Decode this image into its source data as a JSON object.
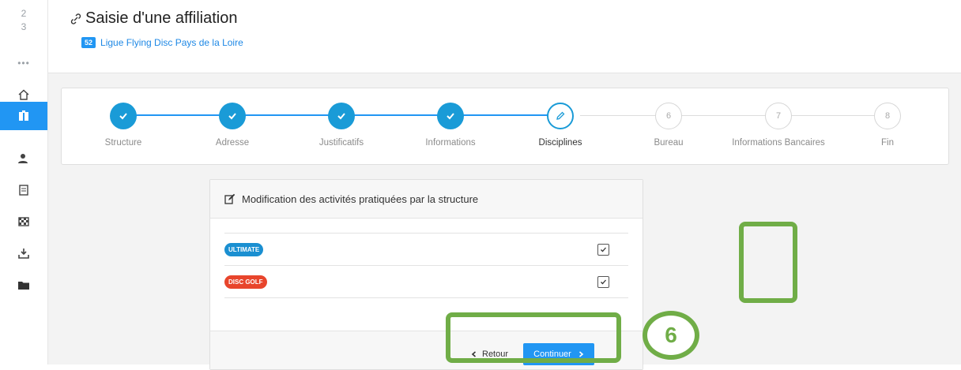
{
  "sidebar": {
    "numbers": [
      "2",
      "3"
    ],
    "more_label": "•••",
    "items": [
      {
        "icon": "home-icon",
        "active": false
      },
      {
        "icon": "building-icon",
        "active": true
      },
      {
        "icon": "users-icon",
        "active": false
      },
      {
        "icon": "document-icon",
        "active": false
      },
      {
        "icon": "checkered-flag-icon",
        "active": false
      },
      {
        "icon": "download-icon",
        "active": false
      },
      {
        "icon": "folder-icon",
        "active": false
      }
    ]
  },
  "header": {
    "title": "Saisie d'une affiliation",
    "badge": "52",
    "org_link": "Ligue Flying Disc Pays de la Loire"
  },
  "stepper": {
    "steps": [
      {
        "label": "Structure",
        "state": "done",
        "number": ""
      },
      {
        "label": "Adresse",
        "state": "done",
        "number": ""
      },
      {
        "label": "Justificatifs",
        "state": "done",
        "number": ""
      },
      {
        "label": "Informations",
        "state": "done",
        "number": ""
      },
      {
        "label": "Disciplines",
        "state": "current",
        "number": ""
      },
      {
        "label": "Bureau",
        "state": "todo",
        "number": "6"
      },
      {
        "label": "Informations Bancaires",
        "state": "todo",
        "number": "7"
      },
      {
        "label": "Fin",
        "state": "todo",
        "number": "8"
      }
    ]
  },
  "panel": {
    "heading": "Modification des activités pratiquées par la structure",
    "disciplines": [
      {
        "label": "ULTIMATE",
        "color": "#1a8fd1",
        "checked": true
      },
      {
        "label": "DISC GOLF",
        "color": "#e8452c",
        "checked": true
      }
    ],
    "back_label": "Retour",
    "next_label": "Continuer"
  },
  "annotation": {
    "step_number": "6",
    "color": "#70ad47"
  }
}
